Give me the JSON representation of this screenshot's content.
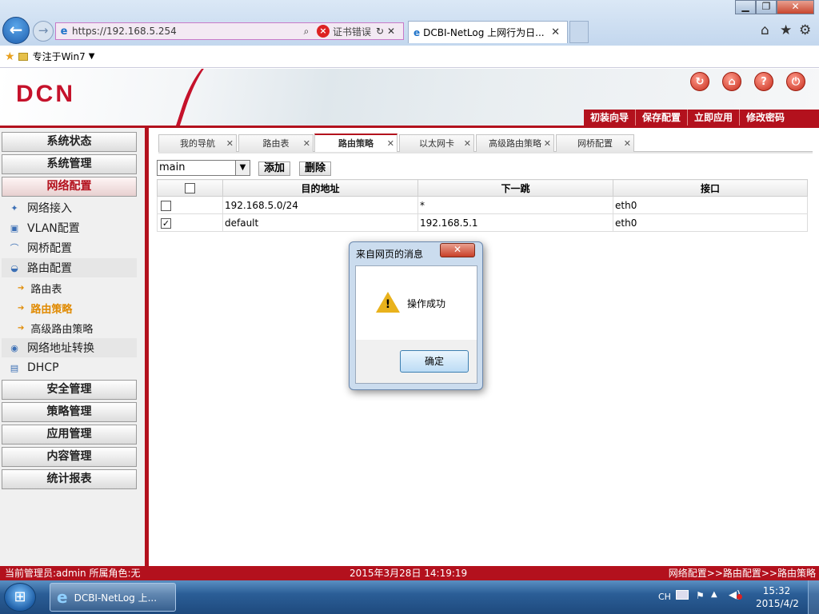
{
  "browser": {
    "url": "https://192.168.5.254",
    "cert_error": "证书错误",
    "tab_title": "DCBI-NetLog 上网行为日...",
    "favorites_item": "专注于Win7"
  },
  "header": {
    "logo": "DCN",
    "menu": [
      "初装向导",
      "保存配置",
      "立即应用",
      "修改密码"
    ]
  },
  "sidebar": {
    "groups_top": [
      "系统状态",
      "系统管理",
      "网络配置"
    ],
    "sub_items": [
      {
        "label": "网络接入",
        "icon": "network-access-icon"
      },
      {
        "label": "VLAN配置",
        "icon": "vlan-icon"
      },
      {
        "label": "网桥配置",
        "icon": "bridge-icon"
      },
      {
        "label": "路由配置",
        "icon": "router-icon"
      }
    ],
    "leaf_items": [
      "路由表",
      "路由策略",
      "高级路由策略"
    ],
    "sub_items_bottom": [
      {
        "label": "网络地址转换",
        "icon": "nat-icon"
      },
      {
        "label": "DHCP",
        "icon": "dhcp-icon"
      }
    ],
    "groups_bottom": [
      "安全管理",
      "策略管理",
      "应用管理",
      "内容管理",
      "统计报表"
    ]
  },
  "content": {
    "tabs": [
      "我的导航",
      "路由表",
      "路由策略",
      "以太网卡",
      "高级路由策略",
      "网桥配置"
    ],
    "active_tab": "路由策略",
    "table_select": "main",
    "add_button": "添加",
    "delete_button": "删除",
    "columns": [
      "目的地址",
      "下一跳",
      "接口"
    ],
    "rows": [
      {
        "checked": false,
        "dest": "192.168.5.0/24",
        "next_hop": "*",
        "iface": "eth0"
      },
      {
        "checked": true,
        "dest": "default",
        "next_hop": "192.168.5.1",
        "iface": "eth0"
      }
    ]
  },
  "dialog": {
    "title": "来自网页的消息",
    "message": "操作成功",
    "ok_label": "确定"
  },
  "status": {
    "admin": "当前管理员:admin  所属角色:无",
    "datetime": "2015年3月28日 14:19:19",
    "breadcrumb": "网络配置>>路由配置>>路由策略"
  },
  "taskbar": {
    "ie_label": "DCBI-NetLog 上...",
    "lang": "CH",
    "time": "15:32",
    "date": "2015/4/2"
  },
  "colors": {
    "brand_red": "#b3111d",
    "accent_orange": "#e08a00"
  }
}
